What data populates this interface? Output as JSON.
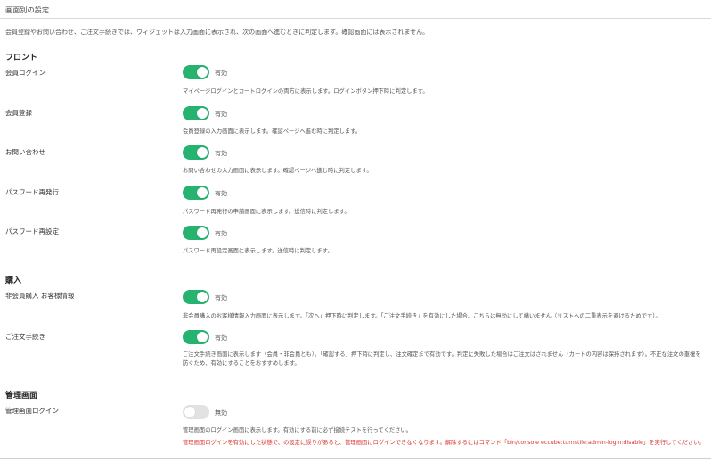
{
  "page": {
    "title": "画面別の設定",
    "description": "会員登録やお問い合わせ、ご注文手続きでは、ウィジェットは入力画面に表示され、次の画面へ進むときに判定します。確認画面には表示されません。"
  },
  "colors": {
    "toggle_on": "#25b36f",
    "toggle_off": "#e2e2e2",
    "warning": "#d9322d"
  },
  "sections": {
    "front": {
      "heading": "フロント",
      "settings": [
        {
          "label": "会員ログイン",
          "enabled": true,
          "state": "有効",
          "help": "マイページログインとカートログインの両方に表示します。ログインボタン押下時に判定します。"
        },
        {
          "label": "会員登録",
          "enabled": true,
          "state": "有効",
          "help": "会員登録の入力画面に表示します。確認ページへ進む時に判定します。"
        },
        {
          "label": "お問い合わせ",
          "enabled": true,
          "state": "有効",
          "help": "お問い合わせの入力画面に表示します。確認ページへ進む時に判定します。"
        },
        {
          "label": "パスワード再発行",
          "enabled": true,
          "state": "有効",
          "help": "パスワード再発行の申請画面に表示します。送信時に判定します。"
        },
        {
          "label": "パスワード再設定",
          "enabled": true,
          "state": "有効",
          "help": "パスワード再設定画面に表示します。送信時に判定します。"
        }
      ]
    },
    "purchase": {
      "heading": "購入",
      "settings": [
        {
          "label": "非会員購入 お客様情報",
          "enabled": true,
          "state": "有効",
          "help": "非会員購入のお客様情報入力画面に表示します。「次へ」押下時に判定します。「ご注文手続き」を有効にした場合、こちらは無効にして構いません（リストへの二重表示を避けるためです）。"
        },
        {
          "label": "ご注文手続き",
          "enabled": true,
          "state": "有効",
          "help": "ご注文手続き画面に表示します（会員・非会員とも）。「確認する」押下時に判定し、注文確定まで有効です。判定に失敗した場合はご注文はされません（カートの内容は保持されます）。不正な注文の重複を防ぐため、有効にすることをおすすめします。"
        }
      ]
    },
    "admin": {
      "heading": "管理画面",
      "settings": [
        {
          "label": "管理画面ログイン",
          "enabled": false,
          "state": "無効",
          "help": "管理画面のログイン画面に表示します。有効にする前に必ず接続テストを行ってください。",
          "warning": "管理画面ログインを有効にした状態で、の設定に誤りがあると、管理画面にログインできなくなります。解除するにはコマンド「bin/console eccube:turnstile:admin-login:disable」を実行してください。"
        }
      ]
    }
  }
}
